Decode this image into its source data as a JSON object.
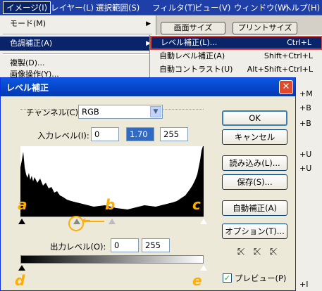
{
  "menubar": {
    "items": [
      "イメージ(I)",
      "レイヤー(L)",
      "選択範囲(S)",
      "フィルタ(T)",
      "ビュー(V)",
      "ウィンドウ(W)",
      "ヘルプ(H)"
    ]
  },
  "image_menu": {
    "items": [
      {
        "label": "モード(M)",
        "arrow": "▶"
      },
      {
        "label": "色調補正(A)",
        "arrow": "▶"
      },
      {
        "label": "複製(D)..."
      },
      {
        "label": "画像操作(Y)..."
      }
    ]
  },
  "top_buttons": {
    "screen_size": "画面サイズ",
    "print_size": "プリントサイズ"
  },
  "adjust_menu": {
    "items": [
      {
        "label": "レベル補正(L)...",
        "shortcut": "Ctrl+L"
      },
      {
        "label": "自動レベル補正(A)",
        "shortcut": "Shift+Ctrl+L"
      },
      {
        "label": "自動コントラスト(U)",
        "shortcut": "Alt+Shift+Ctrl+L"
      }
    ],
    "partial_shortcuts": [
      "+M",
      "+B",
      "+B",
      "+U",
      "+U",
      "+I"
    ]
  },
  "dialog": {
    "title": "レベル補正",
    "close_glyph": "✕",
    "channel_label": "チャンネル(C):",
    "channel_value": "RGB",
    "input_label": "入力レベル(I):",
    "input_values": [
      "0",
      "1.70",
      "255"
    ],
    "output_label": "出力レベル(O):",
    "output_values": [
      "0",
      "255"
    ],
    "buttons": {
      "ok": "OK",
      "cancel": "キャンセル",
      "load": "読み込み(L)...",
      "save": "保存(S)...",
      "auto": "自動補正(A)",
      "options": "オプション(T)..."
    },
    "preview_label": "プレビュー(P)",
    "preview_checked": true,
    "check_glyph": "✓",
    "droppers": [
      "black-point-eyedropper",
      "gray-point-eyedropper",
      "white-point-eyedropper"
    ],
    "dropper_glyph": "⤪"
  },
  "annotations": {
    "a": "a",
    "b": "b",
    "c": "c",
    "d": "d",
    "e": "e",
    "arrow": "←"
  },
  "colors": {
    "accent": "#ffae00",
    "highlight_border": "#e04040",
    "selection": "#0a246a"
  }
}
